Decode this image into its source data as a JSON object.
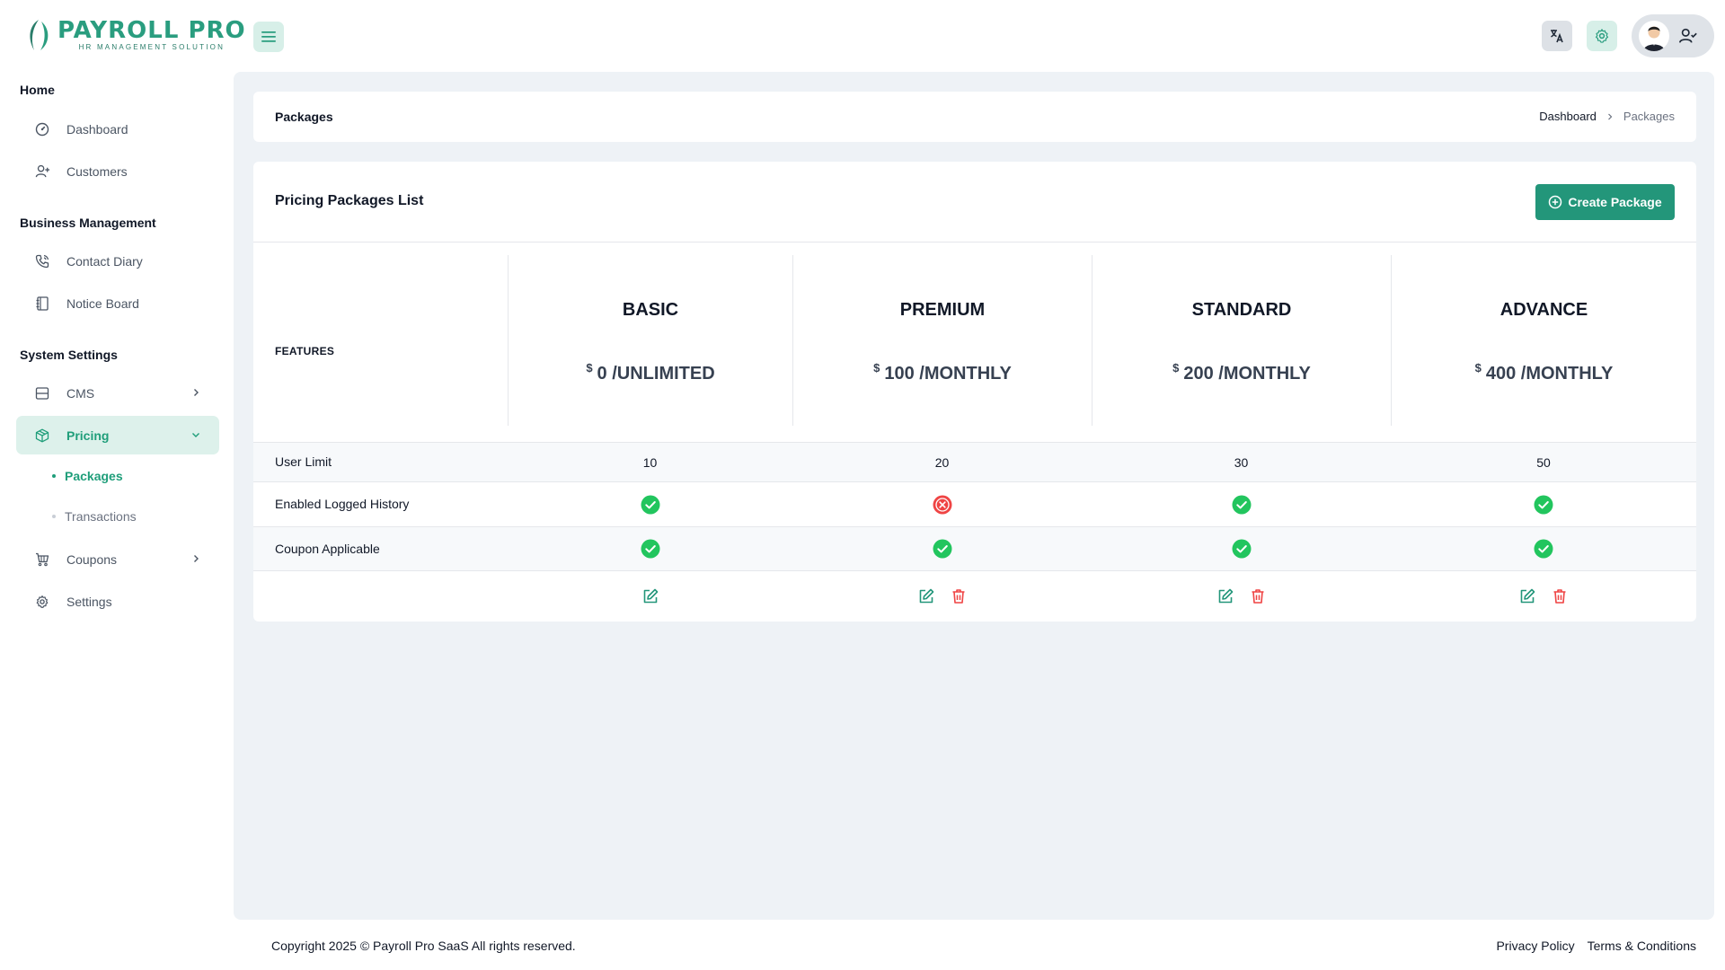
{
  "brand": {
    "name": "PAYROLL PRO",
    "tagline": "HR MANAGEMENT SOLUTION",
    "color": "#2a9d7f"
  },
  "topbar": {
    "menu_icon": "hamburger-icon",
    "language_icon": "translate-icon",
    "settings_icon": "gear-icon",
    "profile_icon": "user-check-icon"
  },
  "sidebar": {
    "sections": [
      {
        "title": "Home",
        "items": [
          {
            "label": "Dashboard",
            "icon": "dashboard-gauge-icon"
          },
          {
            "label": "Customers",
            "icon": "user-plus-icon"
          }
        ]
      },
      {
        "title": "Business Management",
        "items": [
          {
            "label": "Contact Diary",
            "icon": "phone-icon"
          },
          {
            "label": "Notice Board",
            "icon": "notebook-icon"
          }
        ]
      },
      {
        "title": "System Settings",
        "items": [
          {
            "label": "CMS",
            "icon": "layout-icon"
          },
          {
            "label": "Pricing",
            "icon": "package-icon",
            "active": true,
            "children": [
              {
                "label": "Packages",
                "active": true
              },
              {
                "label": "Transactions"
              }
            ]
          },
          {
            "label": "Coupons",
            "icon": "shopping-cart-icon"
          },
          {
            "label": "Settings",
            "icon": "gear-icon"
          }
        ]
      }
    ]
  },
  "page": {
    "title": "Packages",
    "breadcrumb": [
      "Dashboard",
      "Packages"
    ]
  },
  "card": {
    "title": "Pricing Packages List",
    "create_label": "Create Package",
    "features_label": "FEATURES",
    "currency": "$",
    "plans": [
      {
        "name": "BASIC",
        "price": "0",
        "period": "/UNLIMITED",
        "deletable": false
      },
      {
        "name": "PREMIUM",
        "price": "100",
        "period": "/MONTHLY",
        "deletable": true
      },
      {
        "name": "STANDARD",
        "price": "200",
        "period": "/MONTHLY",
        "deletable": true
      },
      {
        "name": "ADVANCE",
        "price": "400",
        "period": "/MONTHLY",
        "deletable": true
      }
    ],
    "features": [
      {
        "name": "User Limit",
        "type": "text",
        "values": [
          "10",
          "20",
          "30",
          "50"
        ]
      },
      {
        "name": "Enabled Logged History",
        "type": "bool",
        "values": [
          true,
          false,
          true,
          true
        ]
      },
      {
        "name": "Coupon Applicable",
        "type": "bool",
        "values": [
          true,
          true,
          true,
          true
        ]
      }
    ]
  },
  "colors": {
    "accent": "#23967a",
    "success": "#22c55e",
    "danger": "#ef4444"
  },
  "footer": {
    "copyright": "Copyright 2025 © Payroll Pro SaaS All rights reserved.",
    "links": [
      "Privacy Policy",
      "Terms & Conditions"
    ]
  }
}
